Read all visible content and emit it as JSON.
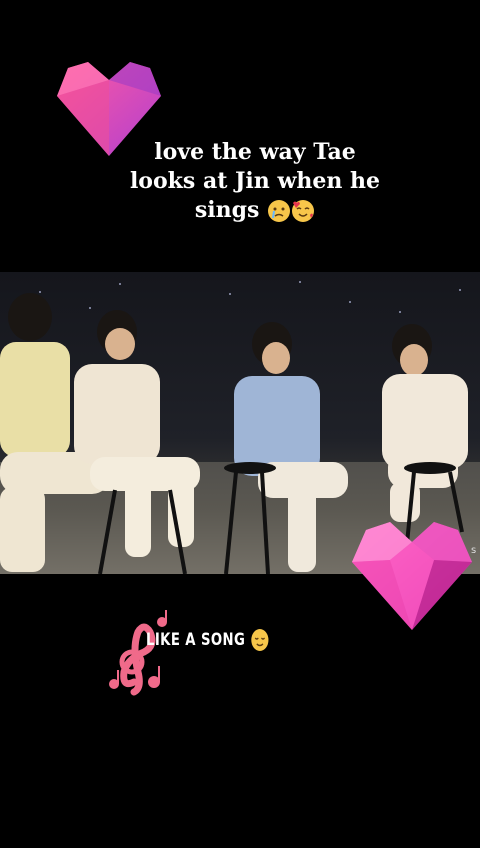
{
  "caption": {
    "line1": "love the way Tae",
    "line2": "looks at Jin when he",
    "line3": "sings",
    "emojis": [
      "crying-face",
      "smiling-face-with-hearts"
    ]
  },
  "sticker_text": "LIKE A SONG",
  "sticker_emoji": "relieved-face",
  "edge_letter": "s",
  "colors": {
    "background": "#000000",
    "heart_pink": "#e8458f",
    "heart_purple": "#c64fd4",
    "note_pink": "#f06a8a"
  }
}
